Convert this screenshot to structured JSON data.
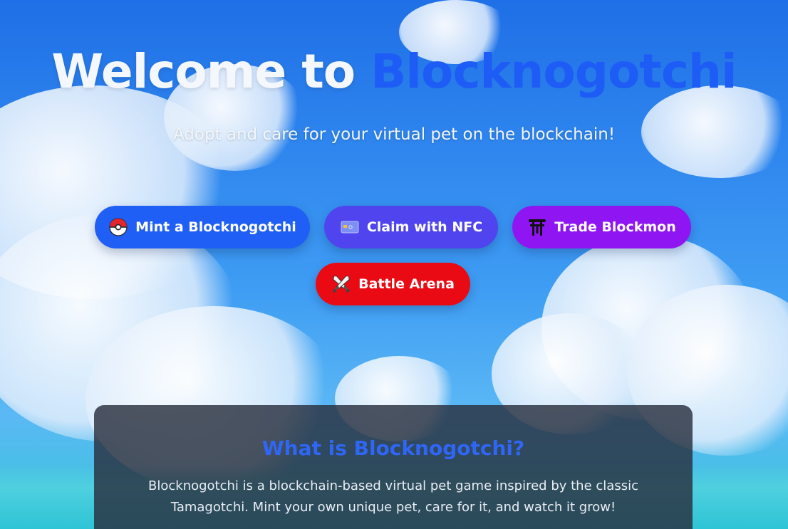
{
  "hero": {
    "title_part1": "Welcome to ",
    "title_part2": "Blocknogotchi",
    "subtitle": "Adopt and care for your virtual pet on the blockchain!"
  },
  "actions": {
    "mint_label": "Mint a Blocknogotchi",
    "nfc_label": "Claim with NFC",
    "trade_label": "Trade Blockmon",
    "battle_label": "Battle Arena"
  },
  "icons": {
    "mint": "pokeball-icon",
    "nfc": "nfc-card-icon",
    "trade": "torii-gate-icon",
    "battle": "crossed-swords-icon"
  },
  "info": {
    "title": "What is Blocknogotchi?",
    "body": "Blocknogotchi is a blockchain-based virtual pet game inspired by the classic Tamagotchi. Mint your own unique pet, care for it, and watch it grow!"
  },
  "colors": {
    "accent_blue": "#1d5cf5",
    "mint_button": "#1f5ff5",
    "nfc_button": "#4f44ee",
    "trade_button": "#8f16f2",
    "battle_button": "#ea0a14"
  }
}
